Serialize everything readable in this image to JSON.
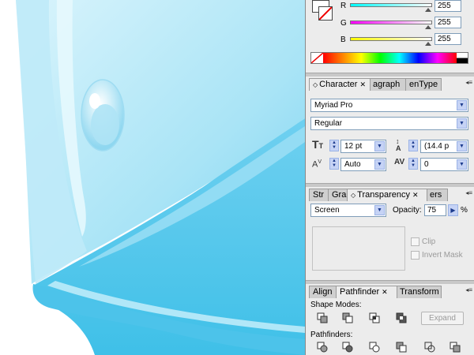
{
  "color_panel": {
    "channels": [
      {
        "label": "R",
        "value": "255",
        "fill": 1.0,
        "gradient": "linear-gradient(90deg,#00ffff,#ffffff)"
      },
      {
        "label": "G",
        "value": "255",
        "fill": 1.0,
        "gradient": "linear-gradient(90deg,#ff00ff,#ffffff)"
      },
      {
        "label": "B",
        "value": "255",
        "fill": 1.0,
        "gradient": "linear-gradient(90deg,#ffff00,#ffffff)"
      }
    ]
  },
  "character_panel": {
    "tabs": [
      "Character",
      "agraph",
      "enType"
    ],
    "font_family": "Myriad Pro",
    "font_style": "Regular",
    "font_size": "12 pt",
    "leading": "(14.4 p",
    "kerning": "Auto",
    "tracking": "0"
  },
  "transparency_panel": {
    "tabs": [
      "Str",
      "Gra",
      "Transparency",
      "ers"
    ],
    "blend_mode": "Screen",
    "opacity_label": "Opacity:",
    "opacity_value": "75",
    "opacity_unit": "%",
    "clip_label": "Clip",
    "invert_mask_label": "Invert Mask"
  },
  "pathfinder_panel": {
    "tabs": [
      "Align",
      "Pathfinder",
      "Transform"
    ],
    "shape_modes_label": "Shape Modes:",
    "expand_label": "Expand",
    "pathfinders_label": "Pathfinders:"
  },
  "colors": {
    "ice_light": "#c5eefa",
    "ice_mid": "#8ed9f2",
    "ice_dark": "#3cbfe6",
    "panel_bg": "#ececec",
    "select_border": "#7f9db9"
  }
}
